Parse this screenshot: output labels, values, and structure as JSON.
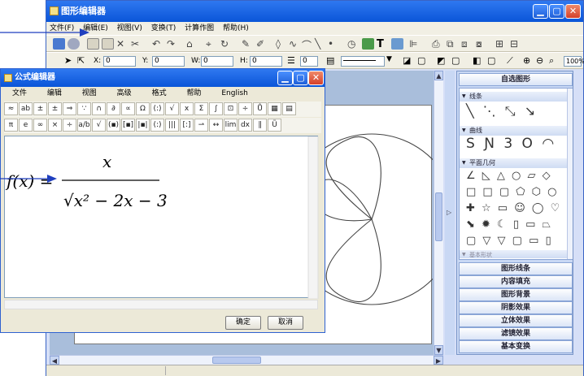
{
  "main_window": {
    "title": "图形编辑器",
    "menu": [
      "文件(F)",
      "编辑(E)",
      "视图(V)",
      "变换(T)",
      "计算作图",
      "帮助(H)"
    ],
    "coord_labels": {
      "x": "X:",
      "y": "Y:",
      "w": "W:",
      "h": "H:"
    },
    "coord_values": {
      "x": "0",
      "y": "0",
      "w": "0",
      "h": "0",
      "line": "0"
    },
    "zoom": "100%"
  },
  "side_panel": {
    "header": "自选图形",
    "sections": [
      {
        "label": "线条",
        "glyphs": "╲ ⋱ ⤡ ↘"
      },
      {
        "label": "曲线",
        "glyphs": "S Ɲ 3 O ◠"
      },
      {
        "label": "平面几何",
        "rows": [
          "∠ ◺ △ ○ ▱ ◇",
          "□ □ ▢ ⬠ ⬡ ○",
          "✚ ☆ ▭ ☺ ◯ ♡",
          "⬊ ✹ ☾ ▯ ▭ ⏢",
          "▢ ▽ ▽ ▢ ▭ ▯"
        ]
      },
      {
        "label": "基本形状"
      }
    ],
    "buttons": [
      "图形线条",
      "内容填充",
      "图形背景",
      "阴影效果",
      "立体效果",
      "滤镜效果",
      "基本变换"
    ]
  },
  "formula_editor": {
    "title": "公式编辑器",
    "menu": [
      "文件",
      "编辑",
      "视图",
      "高级",
      "格式",
      "帮助",
      "English"
    ],
    "symbols_row1": [
      "≈",
      "ab",
      "±",
      "±",
      "⇒",
      "∵",
      "∩",
      "∂",
      "∝",
      "Ω",
      "(:)",
      "√",
      "x",
      "Σ",
      "∫",
      "⊡",
      "÷",
      "Ů",
      "▦",
      "▤"
    ],
    "symbols_row2": [
      "π",
      "e",
      "∞",
      "×",
      "÷",
      "a/b",
      "√",
      "(▪)",
      "[▪]",
      "|▪|",
      "(:)",
      "|||",
      "[:]",
      "⇀",
      "↔",
      "lim",
      "dx",
      "∥",
      "Ũ"
    ],
    "formula": {
      "lhs": "f(x) =",
      "numerator": "x",
      "denominator": "√x² − 2x − 3"
    },
    "ok": "确定",
    "cancel": "取消"
  },
  "colors": {
    "accent": "#0a55d8",
    "annotation_arrow": "#1f3fbf"
  }
}
